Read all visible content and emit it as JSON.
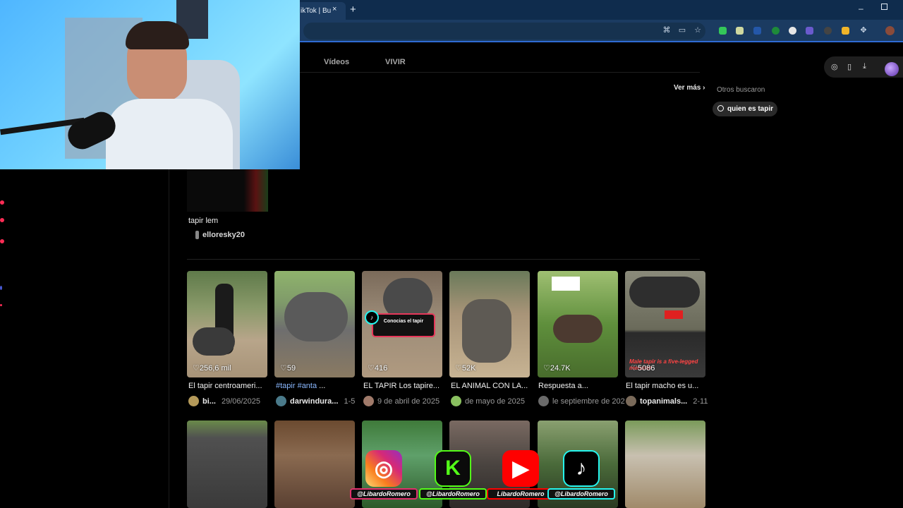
{
  "browser": {
    "tab_title": "ikTok | Bu",
    "tab_close": "×",
    "new_tab": "+",
    "minimize": "–"
  },
  "tiktok": {
    "tabs": [
      "Vídeos",
      "VIVIR"
    ],
    "see_more": "Ver más ›",
    "others_searched_label": "Otros buscaron",
    "suggestion": "quien es tapir",
    "first_result": {
      "title": "tapir lem",
      "user": "elloresky20"
    },
    "row1": [
      {
        "likes": "256,6 mil",
        "title": "El tapir centroameri...",
        "user": "bi...",
        "date": "29/06/2025"
      },
      {
        "likes": "59",
        "title_tag": "#tapir #anta",
        "title_rest": " ...",
        "user": "darwindura...",
        "date": "1-5"
      },
      {
        "likes": "416",
        "title": "EL TAPIR Los tapire...",
        "user": "",
        "date": "9 de abril de 2025",
        "overlay": "Conocias el tapir"
      },
      {
        "likes": "52K",
        "title": "EL ANIMAL CON LA...",
        "user": "",
        "date": "de mayo de 2025"
      },
      {
        "likes": "24.7K",
        "title": "Respuesta a...",
        "user": "",
        "date": "le septiembre de 202"
      },
      {
        "likes": "5086",
        "title": "El tapir macho es u...",
        "user": "topanimals...",
        "date": "2-11",
        "overlay": "Male tapir is a five-legged monster"
      }
    ]
  },
  "social": [
    {
      "network": "instagram-icon",
      "glyph": "◎",
      "handle": "@LibardoRomero",
      "color": "#e1306c"
    },
    {
      "network": "kick-icon",
      "glyph": "K",
      "handle": "@LibardoRomero",
      "color": "#53fc18"
    },
    {
      "network": "youtube-icon",
      "glyph": "▶",
      "handle": "LibardoRomero",
      "color": "#ff0000"
    },
    {
      "network": "tiktok-icon",
      "glyph": "♪",
      "handle": "@LibardoRomero",
      "color": "#25f4ee"
    }
  ],
  "colors": {
    "accent": "#fe2c55",
    "chrome_dark": "#0f2c4d",
    "chrome_toolbar": "#1b3b61"
  }
}
